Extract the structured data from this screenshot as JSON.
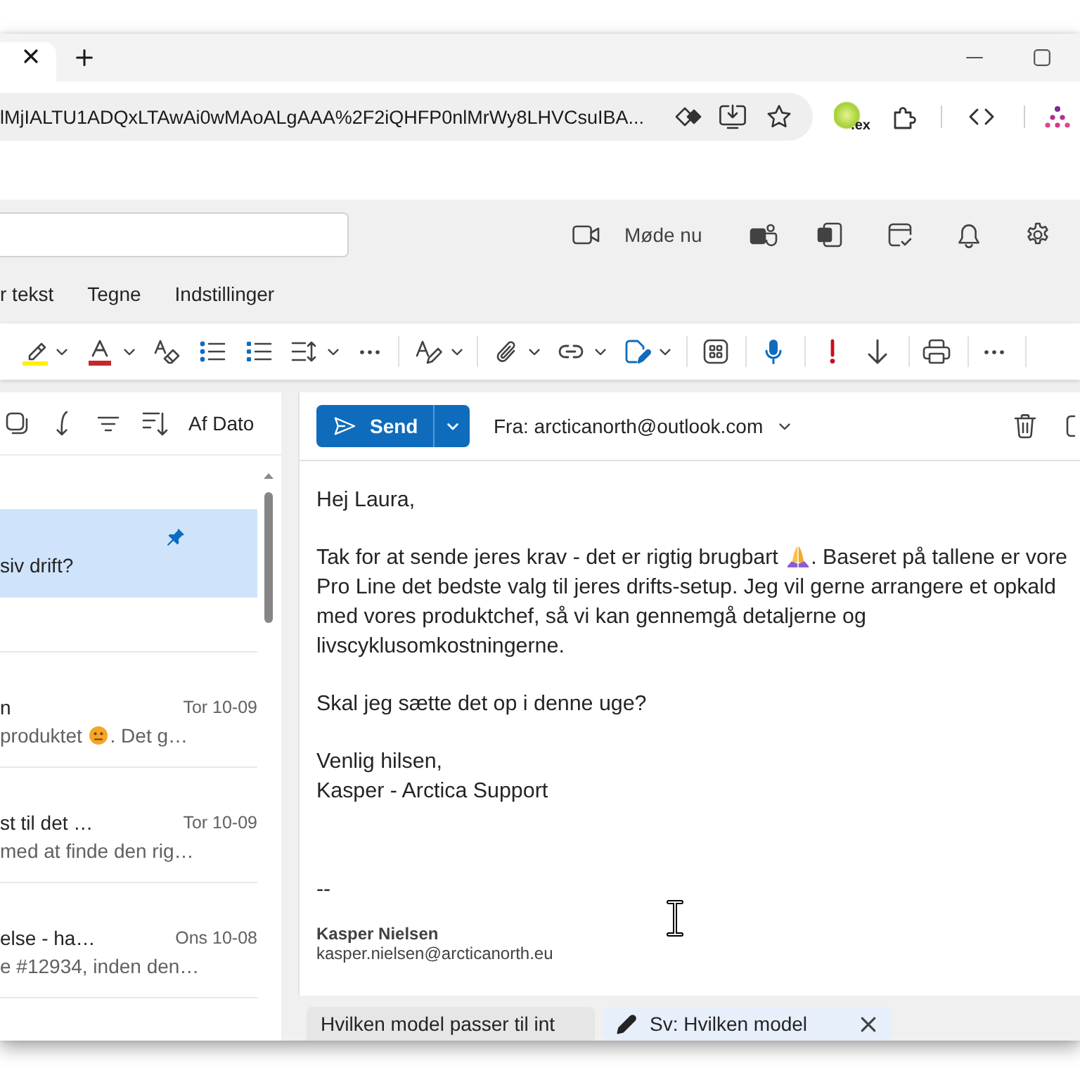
{
  "browser": {
    "tabs": [
      {
        "selected": true
      }
    ],
    "address_bar": {
      "url": "lMjIALTU1ADQxLTAwAi0wMAoALgAAA%2F2iQHFP0nlMrWy8LHVCsuIBA..."
    },
    "extension": {
      "label": ".ex"
    }
  },
  "outlook_header": {
    "meet_now": "Møde nu"
  },
  "ribbon": {
    "tabs": [
      {
        "label": "r tekst",
        "selected": false
      },
      {
        "label": "Tegne",
        "selected": false
      },
      {
        "label": "Indstillinger",
        "selected": false
      }
    ]
  },
  "message_list": {
    "sort_label": "Af Dato",
    "items": [
      {
        "selected": true,
        "pinned": true,
        "subject": "siv drift?"
      },
      {
        "selected": false,
        "pinned": false,
        "subject": "n",
        "time": "Tor 10-09",
        "preview": [
          {
            "kind": "text",
            "text": "produktet "
          },
          {
            "kind": "emoji_face"
          },
          {
            "kind": "text",
            "text": ". Det g…"
          }
        ]
      },
      {
        "selected": false,
        "pinned": false,
        "subject": "st til det …",
        "time": "Tor 10-09",
        "preview": [
          {
            "kind": "text",
            "text": "med at finde den rig…"
          }
        ]
      },
      {
        "selected": false,
        "pinned": false,
        "subject": "else - ha…",
        "time": "Ons 10-08",
        "preview": [
          {
            "kind": "text",
            "text": "e #12934, inden den…"
          }
        ]
      }
    ]
  },
  "compose": {
    "send": "Send",
    "from": "Fra: arcticanorth@outlook.com",
    "body": [
      {
        "runs": [
          {
            "kind": "text",
            "text": "Hej Laura,"
          }
        ]
      },
      {
        "runs": [
          {
            "kind": "text",
            "text": "Tak for at sende jeres krav - det er rigtig brugbart "
          },
          {
            "kind": "emoji_hands"
          },
          {
            "kind": "text",
            "text": ". Baseret på tallene er vore\nPro Line det bedste valg til jeres drifts-setup. Jeg vil gerne arrangere et opkald\nmed vores produktchef, så vi kan gennemgå detaljerne og\nlivscyklusomkostningerne."
          }
        ]
      },
      {
        "runs": [
          {
            "kind": "text",
            "text": "Skal jeg sætte det op i denne uge?"
          }
        ]
      },
      {
        "runs": [
          {
            "kind": "text",
            "text": "Venlig hilsen,\nKasper - Arctica Support"
          }
        ]
      }
    ],
    "signature": {
      "separator": "--",
      "name": "Kasper Nielsen",
      "email": "kasper.nielsen@arcticanorth.eu"
    }
  },
  "draft_tabs": [
    {
      "kind": "message",
      "label": "Hvilken model passer til int",
      "selected": false
    },
    {
      "kind": "draft",
      "label": "Sv: Hvilken model",
      "selected": true
    }
  ]
}
